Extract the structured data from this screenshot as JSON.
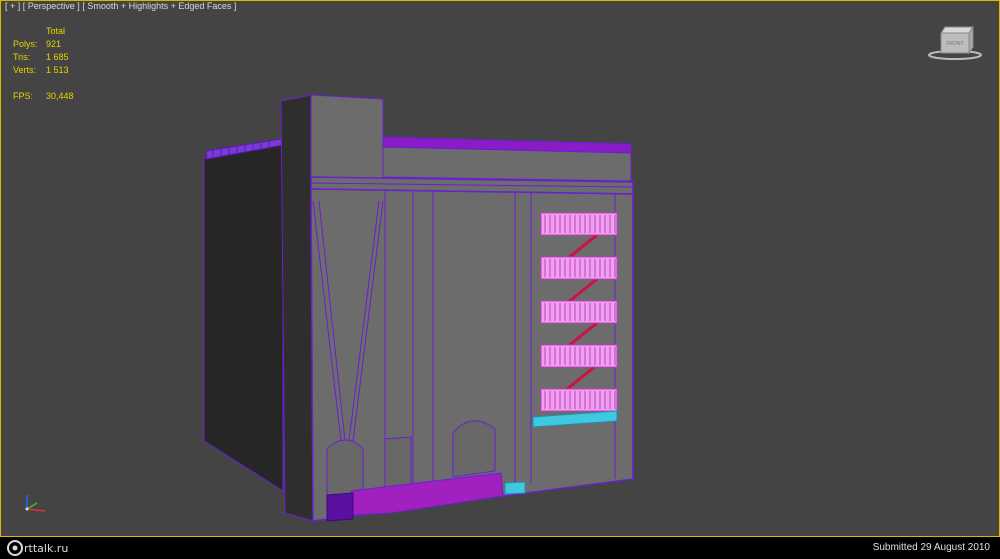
{
  "viewport": {
    "label_parts": [
      "[ + ]",
      "[ Perspective ]",
      "[ Smooth + Highlights + Edged Faces ]"
    ],
    "active_border_color": "#e0b400",
    "background_color": "#444444"
  },
  "stats": {
    "header": "Total",
    "rows": [
      {
        "label": "Polys:",
        "value": "921"
      },
      {
        "label": "Tris:",
        "value": "1 685"
      },
      {
        "label": "Verts:",
        "value": "1 513"
      }
    ],
    "fps_label": "FPS:",
    "fps_value": "30,448",
    "text_color": "#e8d400"
  },
  "viewcube": {
    "icon": "viewcube-icon",
    "face_label": "FRONT"
  },
  "axis_gizmo": {
    "icon": "axis-tripod-icon"
  },
  "model": {
    "wire_color": "#6a1fd0",
    "accent_color": "#a020c0",
    "railing_color": "#ff66ff",
    "stair_color": "#d01040",
    "ledge_color": "#40c8e0"
  },
  "footer": {
    "logo_text": "rttalk.ru",
    "submitted_text": "Submitted 29 August 2010"
  }
}
